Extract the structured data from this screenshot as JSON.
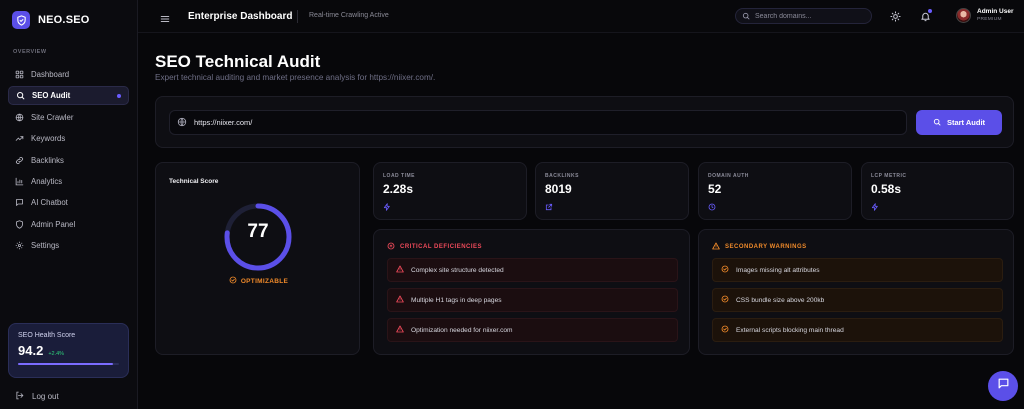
{
  "brand": {
    "name": "NEO.SEO"
  },
  "sidebar": {
    "section_label": "OVERVIEW",
    "items": [
      {
        "label": "Dashboard",
        "icon": "grid-icon"
      },
      {
        "label": "SEO Audit",
        "icon": "search-icon",
        "active": true
      },
      {
        "label": "Site Crawler",
        "icon": "globe-icon"
      },
      {
        "label": "Keywords",
        "icon": "trending-icon"
      },
      {
        "label": "Backlinks",
        "icon": "link-icon"
      },
      {
        "label": "Analytics",
        "icon": "bar-chart-icon"
      },
      {
        "label": "AI Chatbot",
        "icon": "chat-icon"
      },
      {
        "label": "Admin Panel",
        "icon": "shield-icon"
      },
      {
        "label": "Settings",
        "icon": "gear-icon"
      }
    ],
    "health": {
      "title": "SEO Health Score",
      "value": "94.2",
      "delta": "+2.4%",
      "progress": 0.94
    },
    "logout_label": "Log out"
  },
  "header": {
    "title": "Enterprise Dashboard",
    "status": "Real-time Crawling Active",
    "search_placeholder": "Search domains...",
    "user_name": "Admin User",
    "user_role": "PREMIUM"
  },
  "main": {
    "title": "SEO Technical Audit",
    "subtitle": "Expert technical auditing and market presence analysis for https://niixer.com/.",
    "url_value": "https://niixer.com/",
    "audit_button": "Start Audit",
    "score": {
      "title": "Technical Score",
      "value": "77",
      "percent": 77,
      "status": "OPTIMIZABLE"
    },
    "metrics": [
      {
        "label": "LOAD TIME",
        "value": "2.28s",
        "icon": "bolt-icon"
      },
      {
        "label": "BACKLINKS",
        "value": "8019",
        "icon": "external-link-icon"
      },
      {
        "label": "DOMAIN AUTH",
        "value": "52",
        "icon": "clock-icon"
      },
      {
        "label": "LCP METRIC",
        "value": "0.58s",
        "icon": "bolt-icon"
      }
    ],
    "critical": {
      "title": "CRITICAL DEFICIENCIES",
      "items": [
        "Complex site structure detected",
        "Multiple H1 tags in deep pages",
        "Optimization needed for niixer.com"
      ]
    },
    "warnings": {
      "title": "SECONDARY WARNINGS",
      "items": [
        "Images missing alt attributes",
        "CSS bundle size above 200kb",
        "External scripts blocking main thread"
      ]
    }
  },
  "colors": {
    "accent": "#5b4fe8",
    "critical": "#ef4a5a",
    "warning": "#f08a2a",
    "success": "#2ecf7a"
  }
}
